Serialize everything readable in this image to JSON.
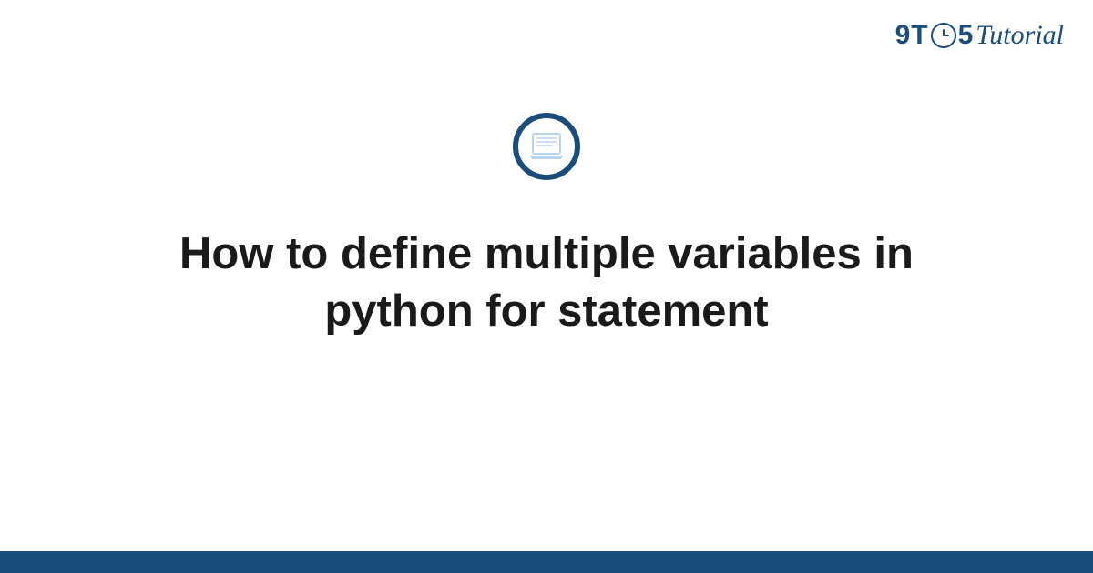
{
  "brand": {
    "prefix": "9T",
    "suffix": "5",
    "word": "Tutorial"
  },
  "icon": {
    "name": "laptop-icon"
  },
  "title": "How to define multiple variables in python for statement",
  "colors": {
    "primary": "#1a4d7a",
    "text": "#1a1a1a",
    "iconFill": "#b8d4ea"
  }
}
